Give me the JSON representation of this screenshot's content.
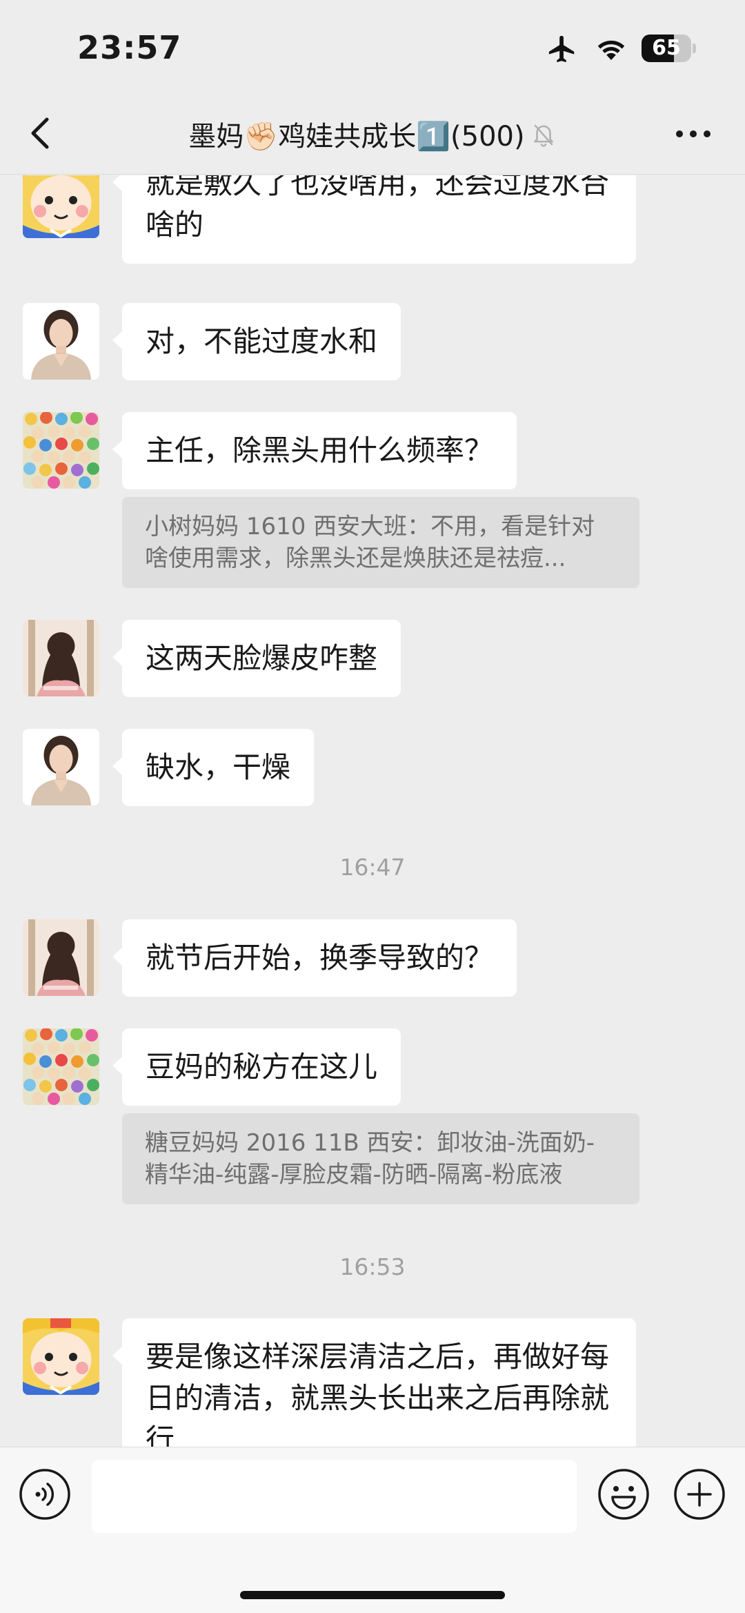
{
  "status_bar": {
    "time": "23:57",
    "battery_level": "65",
    "battery_fraction": 0.65,
    "icons": [
      "airplane-icon",
      "wifi-icon",
      "battery-icon"
    ]
  },
  "header": {
    "title": "墨妈✊🏻鸡娃共成长1️⃣(500)",
    "icons": [
      "back-icon",
      "bell-off-icon",
      "more-icon"
    ]
  },
  "messages": [
    {
      "avatar": "cartoon-avatar",
      "text": "就是敷久了也没啥用，还会过度水合啥的"
    },
    {
      "avatar": "woman-avatar",
      "text": "对，不能过度水和"
    },
    {
      "avatar": "crowd-avatar",
      "text": "主任，除黑头用什么频率？",
      "quote": "小树妈妈 1610 西安大班：不用，看是针对啥使用需求，除黑头还是焕肤还是祛痘..."
    },
    {
      "avatar": "girl-avatar",
      "text": "这两天脸爆皮咋整"
    },
    {
      "avatar": "woman-avatar",
      "text": "缺水，干燥"
    },
    {
      "avatar": "girl-avatar",
      "text": "就节后开始，换季导致的？"
    },
    {
      "avatar": "crowd-avatar",
      "text": "豆妈的秘方在这儿",
      "quote": "糖豆妈妈 2016 11B 西安：卸妆油-洗面奶-精华油-纯露-厚脸皮霜-防晒-隔离-粉底液"
    },
    {
      "avatar": "cartoon-avatar",
      "text": "要是像这样深层清洁之后，再做好每日的清洁，就黑头长出来之后再除就行"
    }
  ],
  "timestamps": [
    "16:47",
    "16:53"
  ],
  "input_bar": {
    "icons": [
      "voice-icon",
      "emoji-icon",
      "plus-icon"
    ],
    "value": ""
  },
  "colors": {
    "background": "#ededed",
    "bubble": "#ffffff",
    "quote": "#dedede",
    "input_bar": "#f7f7f7"
  }
}
